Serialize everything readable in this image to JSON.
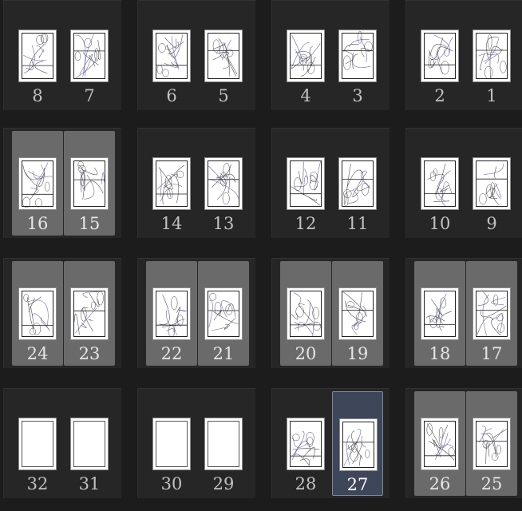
{
  "spreads": [
    {
      "pages": [
        {
          "number": "8",
          "state": "normal",
          "content": "sketch"
        },
        {
          "number": "7",
          "state": "normal",
          "content": "sketch"
        }
      ]
    },
    {
      "pages": [
        {
          "number": "6",
          "state": "normal",
          "content": "sketch"
        },
        {
          "number": "5",
          "state": "normal",
          "content": "sketch"
        }
      ]
    },
    {
      "pages": [
        {
          "number": "4",
          "state": "normal",
          "content": "sketch"
        },
        {
          "number": "3",
          "state": "normal",
          "content": "sketch"
        }
      ]
    },
    {
      "pages": [
        {
          "number": "2",
          "state": "normal",
          "content": "sketch"
        },
        {
          "number": "1",
          "state": "normal",
          "content": "sketch"
        }
      ]
    },
    {
      "pages": [
        {
          "number": "16",
          "state": "selected",
          "content": "sketch"
        },
        {
          "number": "15",
          "state": "selected",
          "content": "sketch"
        }
      ]
    },
    {
      "pages": [
        {
          "number": "14",
          "state": "normal",
          "content": "sketch"
        },
        {
          "number": "13",
          "state": "normal",
          "content": "sketch"
        }
      ]
    },
    {
      "pages": [
        {
          "number": "12",
          "state": "normal",
          "content": "sketch"
        },
        {
          "number": "11",
          "state": "normal",
          "content": "sketch"
        }
      ]
    },
    {
      "pages": [
        {
          "number": "10",
          "state": "normal",
          "content": "sketch"
        },
        {
          "number": "9",
          "state": "normal",
          "content": "sketch"
        }
      ]
    },
    {
      "pages": [
        {
          "number": "24",
          "state": "selected",
          "content": "sketch"
        },
        {
          "number": "23",
          "state": "selected",
          "content": "sketch"
        }
      ]
    },
    {
      "pages": [
        {
          "number": "22",
          "state": "selected",
          "content": "sketch"
        },
        {
          "number": "21",
          "state": "selected",
          "content": "sketch"
        }
      ]
    },
    {
      "pages": [
        {
          "number": "20",
          "state": "selected",
          "content": "sketch"
        },
        {
          "number": "19",
          "state": "selected",
          "content": "sketch"
        }
      ]
    },
    {
      "pages": [
        {
          "number": "18",
          "state": "selected",
          "content": "sketch"
        },
        {
          "number": "17",
          "state": "selected",
          "content": "sketch"
        }
      ]
    },
    {
      "pages": [
        {
          "number": "32",
          "state": "normal",
          "content": "blank"
        },
        {
          "number": "31",
          "state": "normal",
          "content": "blank"
        }
      ]
    },
    {
      "pages": [
        {
          "number": "30",
          "state": "normal",
          "content": "blank"
        },
        {
          "number": "29",
          "state": "normal",
          "content": "blank"
        }
      ]
    },
    {
      "pages": [
        {
          "number": "28",
          "state": "normal",
          "content": "sketch"
        },
        {
          "number": "27",
          "state": "current",
          "content": "sketch"
        }
      ]
    },
    {
      "pages": [
        {
          "number": "26",
          "state": "selected",
          "content": "sketch"
        },
        {
          "number": "25",
          "state": "selected",
          "content": "sketch"
        }
      ]
    }
  ],
  "colors": {
    "background": "#1c1c1c",
    "spread": "#262626",
    "selected_page": "#6a6a6a",
    "current_page": "#3e465a"
  },
  "icons": {
    "thumbnail": "page-thumbnail-icon"
  }
}
